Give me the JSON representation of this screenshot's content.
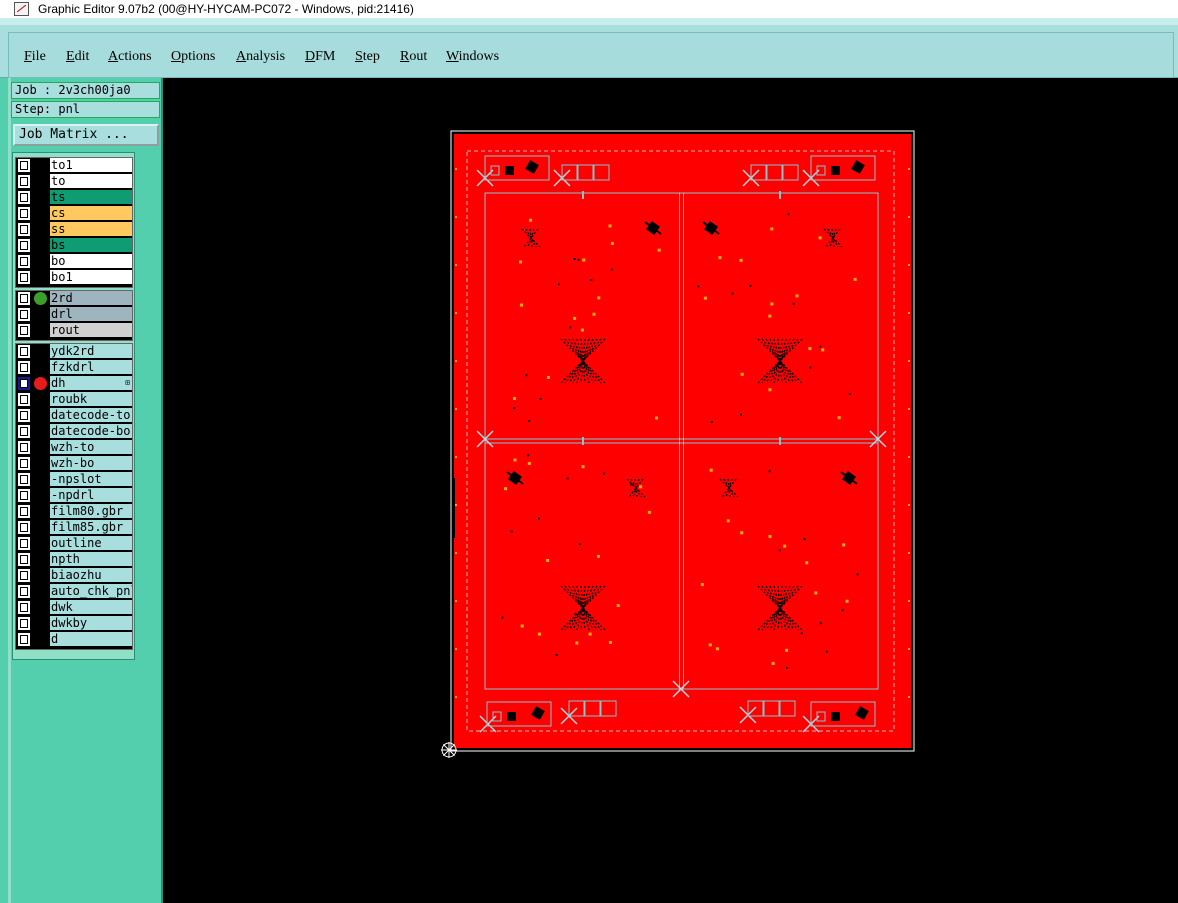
{
  "window": {
    "title": "Graphic Editor 9.07b2 (00@HY-HYCAM-PC072 - Windows, pid:21416)",
    "icon": "graphic-editor-app-icon"
  },
  "menu": {
    "items": [
      {
        "label": "File"
      },
      {
        "label": "Edit"
      },
      {
        "label": "Actions"
      },
      {
        "label": "Options"
      },
      {
        "label": "Analysis"
      },
      {
        "label": "DFM"
      },
      {
        "label": "Step"
      },
      {
        "label": "Rout"
      },
      {
        "label": "Windows"
      }
    ]
  },
  "job": {
    "job_text": "Job : 2v3ch00ja0",
    "step_text": "Step: pnl",
    "matrix_button": "Job Matrix ..."
  },
  "layer_groups": [
    [
      {
        "name": "to1",
        "color": "#ffffff"
      },
      {
        "name": "to",
        "color": "#ffffff"
      },
      {
        "name": "ts",
        "color": "#0f9c72"
      },
      {
        "name": "cs",
        "color": "#ffc960"
      },
      {
        "name": "ss",
        "color": "#ffc960"
      },
      {
        "name": "bs",
        "color": "#0f9c72"
      },
      {
        "name": "bo",
        "color": "#ffffff"
      },
      {
        "name": "bo1",
        "color": "#ffffff"
      }
    ],
    [
      {
        "name": "2rd",
        "color": "#9eb5c0",
        "indicator": "#3ca028"
      },
      {
        "name": "drl",
        "color": "#9eb5c0"
      },
      {
        "name": "rout",
        "color": "#d0d0d0"
      }
    ],
    [
      {
        "name": "ydk2rd",
        "color": "#a8dede"
      },
      {
        "name": "fzkdrl",
        "color": "#a8dede"
      },
      {
        "name": "dh",
        "color": "#a8dede",
        "indicator": "#e81b1b",
        "selected": true,
        "mark": "⊞"
      },
      {
        "name": "roubk",
        "color": "#a8dede"
      },
      {
        "name": "datecode-to",
        "color": "#a8dede"
      },
      {
        "name": "datecode-bo",
        "color": "#a8dede"
      },
      {
        "name": "wzh-to",
        "color": "#a8dede"
      },
      {
        "name": "wzh-bo",
        "color": "#a8dede"
      },
      {
        "name": "-npslot",
        "color": "#a8dede"
      },
      {
        "name": "-npdrl",
        "color": "#a8dede"
      },
      {
        "name": "film80.gbr",
        "color": "#a8dede"
      },
      {
        "name": "film85.gbr",
        "color": "#a8dede"
      },
      {
        "name": "outline",
        "color": "#a8dede"
      },
      {
        "name": "npth",
        "color": "#a8dede"
      },
      {
        "name": "biaozhu",
        "color": "#a8dede"
      },
      {
        "name": "auto_chk_pnl",
        "color": "#a8dede"
      },
      {
        "name": "dwk",
        "color": "#a8dede"
      },
      {
        "name": "dwkby",
        "color": "#a8dede"
      },
      {
        "name": "d",
        "color": "#a8dede"
      }
    ]
  ],
  "canvas": {
    "background": "#000000",
    "panel_fill": "#ff0000",
    "outline_color": "#ffffff",
    "grid_color": "#87c4cc",
    "pad_color": "#ffb000",
    "marking_color": "#000000",
    "panel_grid": {
      "columns": 2,
      "rows": 2
    }
  }
}
